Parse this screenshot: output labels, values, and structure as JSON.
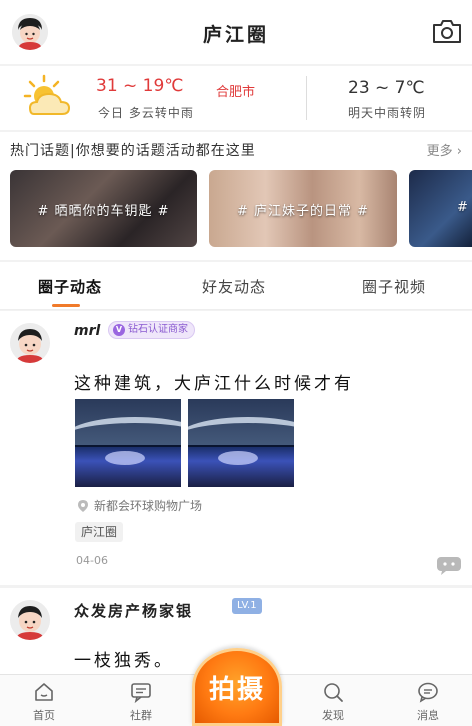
{
  "header": {
    "title": "庐江圈",
    "avatar_icon": "user-avatar",
    "camera_icon": "camera-icon"
  },
  "weather": {
    "today_temp": "31 ~ 19℃",
    "city": "合肥市",
    "today_desc": "今日 多云转中雨",
    "tomorrow_temp": "23 ~ 7℃",
    "tomorrow_desc": "明天中雨转阴",
    "icon": "partly-cloudy-icon"
  },
  "topics": {
    "heading": "热门话题|你想要的话题活动都在这里",
    "more": "更多",
    "cards": [
      {
        "label": "# 晒晒你的车钥匙 #"
      },
      {
        "label": "# 庐江妹子的日常 #"
      },
      {
        "label": "#"
      }
    ]
  },
  "tabs": [
    {
      "label": "圈子动态",
      "active": true
    },
    {
      "label": "好友动态",
      "active": false
    },
    {
      "label": "圈子视频",
      "active": false
    }
  ],
  "posts": [
    {
      "username": "mrl",
      "badge": "钻石认证商家",
      "badge_icon": "V",
      "content": "这种建筑，大庐江什么时候才有",
      "location": "新都会环球购物广场",
      "tag": "庐江圈",
      "date": "04-06"
    },
    {
      "username": "众发房产杨家银",
      "badge": "LV.1",
      "content": "一枝独秀。"
    }
  ],
  "bottom_nav": [
    {
      "label": "首页",
      "icon": "home-icon"
    },
    {
      "label": "社群",
      "icon": "chat-icon"
    },
    {
      "label": "拍摄",
      "icon": "shoot-button"
    },
    {
      "label": "发现",
      "icon": "discover-icon"
    },
    {
      "label": "消息",
      "icon": "message-icon"
    }
  ],
  "colors": {
    "accent": "#f07a2a",
    "temp_red": "#e03a3a",
    "shoot_orange": "#ff7a12"
  }
}
